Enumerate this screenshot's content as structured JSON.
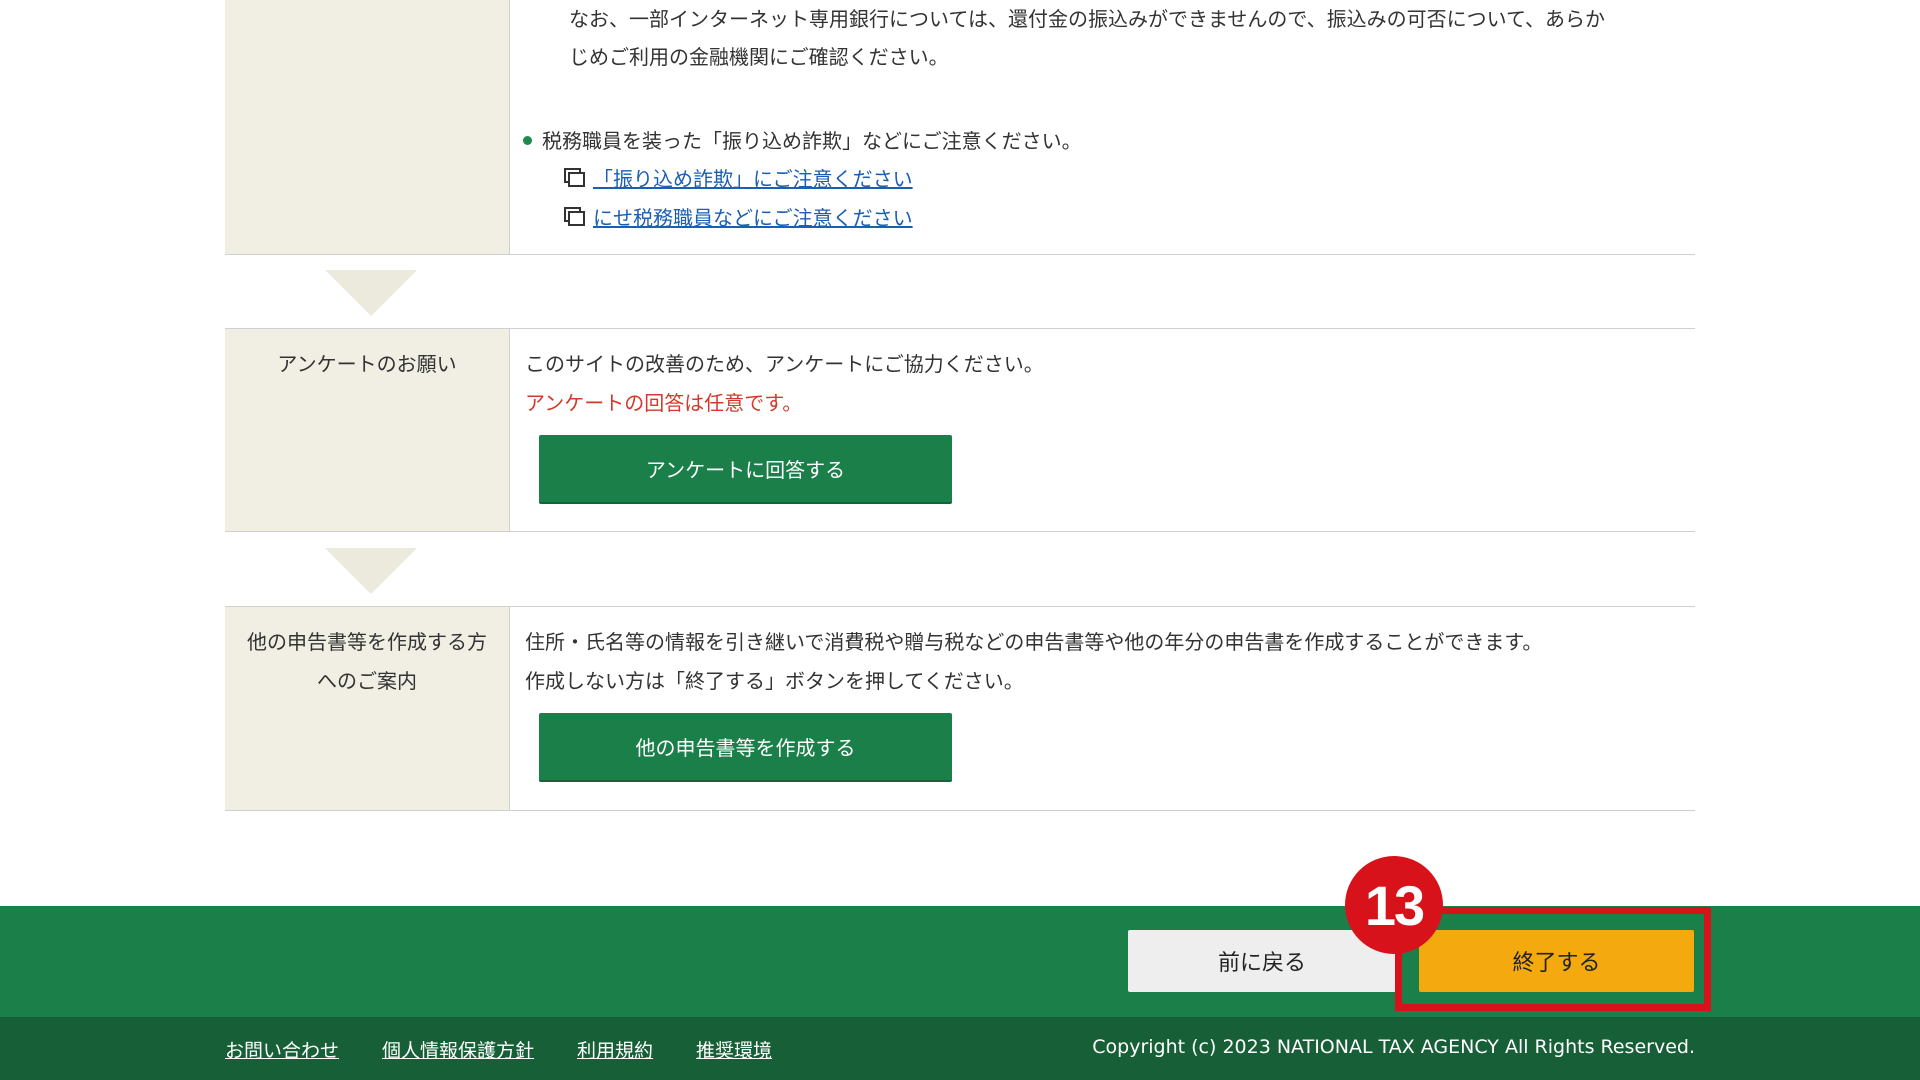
{
  "refund_section": {
    "note_line1": "なお、一部インターネット専用銀行については、還付金の振込みができませんので、振込みの可否について、あらか",
    "note_line2": "じめご利用の金融機関にご確認ください。",
    "fraud_bullet": "税務職員を装った「振り込め詐欺」などにご注意ください。",
    "link1": "「振り込め詐欺」にご注意ください",
    "link2": "にせ税務職員などにご注意ください"
  },
  "survey": {
    "label": "アンケートのお願い",
    "line1": "このサイトの改善のため、アンケートにご協力ください。",
    "optional_note": "アンケートの回答は任意です。",
    "button": "アンケートに回答する"
  },
  "other_forms": {
    "label_line1": "他の申告書等を作成する方",
    "label_line2": "へのご案内",
    "line1": "住所・氏名等の情報を引き継いで消費税や贈与税などの申告書等や他の年分の申告書を作成することができます。",
    "line2": "作成しない方は「終了する」ボタンを押してください。",
    "button": "他の申告書等を作成する"
  },
  "nav": {
    "back": "前に戻る",
    "finish": "終了する",
    "step_number": "13"
  },
  "footer": {
    "links": [
      "お問い合わせ",
      "個人情報保護方針",
      "利用規約",
      "推奨環境"
    ],
    "copyright": "Copyright (c) 2023 NATIONAL TAX AGENCY All Rights Reserved."
  },
  "colors": {
    "primary_green": "#1b7f4a",
    "dark_green": "#165f37",
    "finish_yellow": "#f4a90f",
    "highlight_red": "#d8121b",
    "label_bg": "#f1efe4"
  }
}
